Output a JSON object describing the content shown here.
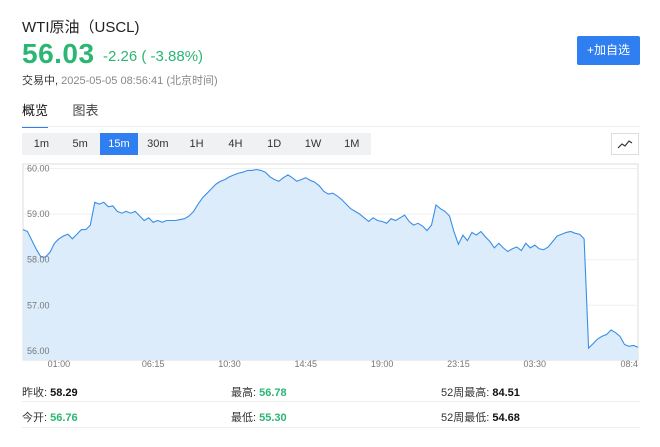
{
  "header": {
    "title": "WTI原油（USCL)",
    "price": "56.03",
    "change": "-2.26 ( -3.88%)",
    "status_label": "交易中,",
    "timestamp": "2025-05-05 08:56:41 (北京时间)",
    "add_button": "+加自选"
  },
  "tabs": [
    {
      "label": "概览",
      "active": true
    },
    {
      "label": "图表",
      "active": false
    }
  ],
  "periods": [
    "1m",
    "5m",
    "15m",
    "30m",
    "1H",
    "4H",
    "1D",
    "1W",
    "1M"
  ],
  "active_period": "15m",
  "colors": {
    "accent": "#2f7ff0",
    "up": "#2bb673",
    "line": "#3a8ee6",
    "fill": "#dcecfb"
  },
  "chart_data": {
    "type": "area",
    "ylim": [
      55.8,
      60.1
    ],
    "yticks": [
      "60.00",
      "59.00",
      "58.00",
      "57.00",
      "56.00"
    ],
    "ytick_values": [
      60,
      59,
      58,
      57,
      56
    ],
    "xticks": [
      "01:00",
      "06:15",
      "10:30",
      "14:45",
      "19:00",
      "23:15",
      "03:30",
      "08:4"
    ],
    "xtick_index": [
      8,
      29,
      46,
      63,
      80,
      97,
      114,
      131
    ],
    "values": [
      58.66,
      58.62,
      58.42,
      58.22,
      58.06,
      58.06,
      58.16,
      58.36,
      58.46,
      58.52,
      58.56,
      58.46,
      58.56,
      58.66,
      58.66,
      58.76,
      59.26,
      59.22,
      59.26,
      59.16,
      59.18,
      59.06,
      59.02,
      59.06,
      59.02,
      59.06,
      58.96,
      58.86,
      58.92,
      58.82,
      58.86,
      58.82,
      58.86,
      58.86,
      58.86,
      58.88,
      58.9,
      58.96,
      59.06,
      59.22,
      59.36,
      59.46,
      59.56,
      59.66,
      59.72,
      59.76,
      59.82,
      59.86,
      59.9,
      59.92,
      59.96,
      59.96,
      59.98,
      59.96,
      59.92,
      59.82,
      59.76,
      59.72,
      59.8,
      59.86,
      59.8,
      59.72,
      59.76,
      59.8,
      59.74,
      59.7,
      59.62,
      59.5,
      59.44,
      59.46,
      59.4,
      59.32,
      59.22,
      59.12,
      59.06,
      59.0,
      58.92,
      58.84,
      58.92,
      58.86,
      58.84,
      58.8,
      58.9,
      58.86,
      58.92,
      58.98,
      58.84,
      58.76,
      58.8,
      58.74,
      58.64,
      58.76,
      59.2,
      59.12,
      59.06,
      58.96,
      58.62,
      58.34,
      58.54,
      58.42,
      58.6,
      58.54,
      58.62,
      58.5,
      58.4,
      58.26,
      58.36,
      58.26,
      58.18,
      58.24,
      58.28,
      58.2,
      58.36,
      58.26,
      58.32,
      58.24,
      58.22,
      58.28,
      58.4,
      58.52,
      58.56,
      58.6,
      58.62,
      58.58,
      58.56,
      58.46,
      56.06,
      56.16,
      56.26,
      56.32,
      56.36,
      56.46,
      56.4,
      56.32,
      56.14,
      56.1,
      56.12,
      56.08
    ]
  },
  "stats": [
    {
      "label": "昨收:",
      "value": "58.29",
      "color": "black"
    },
    {
      "label": "最高:",
      "value": "56.78",
      "color": "green"
    },
    {
      "label": "52周最高:",
      "value": "84.51",
      "color": "black"
    },
    {
      "label": "今开:",
      "value": "56.76",
      "color": "green"
    },
    {
      "label": "最低:",
      "value": "55.30",
      "color": "green"
    },
    {
      "label": "52周最低:",
      "value": "54.68",
      "color": "black"
    }
  ]
}
